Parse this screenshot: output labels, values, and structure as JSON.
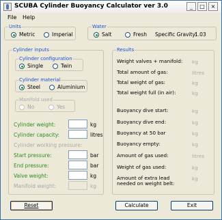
{
  "window": {
    "title": "SCUBA Cylinder Buoyancy Calculator ver 3.0"
  },
  "menu": {
    "file_label": "File",
    "help_label": "Help"
  },
  "units": {
    "legend": "Units",
    "options": [
      {
        "label": "Metric",
        "selected": true
      },
      {
        "label": "Imperial",
        "selected": false
      }
    ]
  },
  "water": {
    "legend": "Water",
    "options": [
      {
        "label": "Salt",
        "selected": true
      },
      {
        "label": "Fresh",
        "selected": false
      }
    ],
    "specific_gravity_label": "Specific Gravity:",
    "specific_gravity_value": "1.03"
  },
  "cylinder_inputs": {
    "legend": "Cylinder inputs",
    "configuration": {
      "legend": "Cylinder configuration",
      "options": [
        {
          "label": "Single",
          "selected": true
        },
        {
          "label": "Twin",
          "selected": false
        }
      ]
    },
    "material": {
      "legend": "Cylinder material",
      "options": [
        {
          "label": "Steel",
          "selected": true
        },
        {
          "label": "Aluminium",
          "selected": false
        }
      ]
    },
    "manifold": {
      "legend": "Manifold used",
      "options": [
        {
          "label": "No",
          "selected": true
        },
        {
          "label": "Yes",
          "selected": false
        }
      ]
    },
    "fields": [
      {
        "label": "Cylinder weight:",
        "unit": "kg",
        "value": "",
        "enabled": true
      },
      {
        "label": "Cylinder capacity:",
        "unit": "litres",
        "value": "",
        "enabled": true
      },
      {
        "label": "Cylinder working pressure:",
        "unit": "",
        "value": "",
        "enabled": false
      },
      {
        "label": "Start pressure:",
        "unit": "bar",
        "value": "",
        "enabled": true
      },
      {
        "label": "End pressure:",
        "unit": "bar",
        "value": "",
        "enabled": true
      },
      {
        "label": "Valve weight:",
        "unit": "kg",
        "value": "",
        "enabled": true
      },
      {
        "label": "Manifold weight:",
        "unit": "kg",
        "value": "",
        "enabled": false
      }
    ]
  },
  "results": {
    "legend": "Results",
    "rows": [
      {
        "label": "Weight valves + manifold:",
        "unit": "kg"
      },
      {
        "label": "Total amount of gas:",
        "unit": "litres"
      },
      {
        "label": "Total weight of gas:",
        "unit": "kg"
      },
      {
        "label": "Total weight full (in air):",
        "unit": "kg"
      },
      {
        "label": "Buoyancy dive start:",
        "unit": "kg"
      },
      {
        "label": "Buoyancy dive end:",
        "unit": "kg"
      },
      {
        "label": "Buoyancy at 50 bar",
        "unit": "kg"
      },
      {
        "label": "Buoyancy empty:",
        "unit": "kg"
      },
      {
        "label": "Amount of gas used:",
        "unit": "litres"
      },
      {
        "label": "Weight of gas used:",
        "unit": "kg"
      },
      {
        "label": "Amount of extra lead needed on weight belt:",
        "unit": "kg"
      }
    ]
  },
  "buttons": {
    "reset_label": "Reset",
    "calculate_label": "Calculate",
    "exit_label": "Exit"
  }
}
